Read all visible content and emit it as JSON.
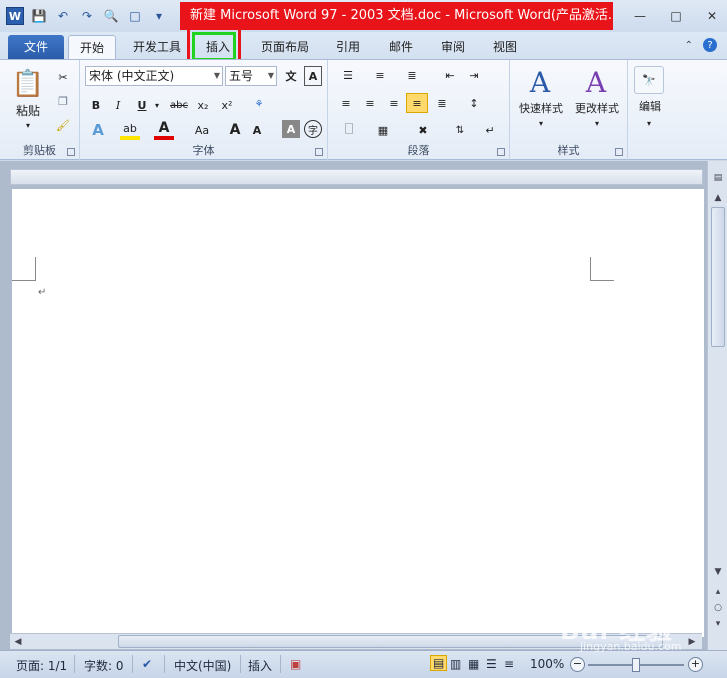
{
  "window": {
    "title": "新建 Microsoft Word 97 - 2003 文档.doc  -  Microsoft Word(产品激活..."
  },
  "tabs": [
    {
      "label": "文件"
    },
    {
      "label": "开始"
    },
    {
      "label": "开发工具"
    },
    {
      "label": "插入"
    },
    {
      "label": "页面布局"
    },
    {
      "label": "引用"
    },
    {
      "label": "邮件"
    },
    {
      "label": "审阅"
    },
    {
      "label": "视图"
    }
  ],
  "ribbon": {
    "clipboard": {
      "label": "剪贴板",
      "paste": "粘贴"
    },
    "font": {
      "label": "字体",
      "font_name": "宋体 (中文正文)",
      "font_size": "五号",
      "bold": "B",
      "italic": "I",
      "underline": "U",
      "strike": "abc",
      "subscript": "x₂",
      "superscript": "x²",
      "grow": "A",
      "shrink": "A",
      "case": "Aa"
    },
    "paragraph": {
      "label": "段落"
    },
    "styles": {
      "label": "样式",
      "quick_styles": "快速样式",
      "change_styles": "更改样式"
    },
    "editing": {
      "label": "编辑"
    }
  },
  "statusbar": {
    "page": "页面: 1/1",
    "words": "字数: 0",
    "language": "中文(中国)",
    "mode": "插入",
    "zoom": "100%"
  },
  "watermark": {
    "brand": "Bai 经验",
    "url": "jingyan.baidu.com"
  },
  "colors": {
    "title_bg": "#e8141a",
    "file_tab": "#2a5ba8",
    "highlight_outer": "#e8141a",
    "highlight_inner": "#1fd31f"
  }
}
